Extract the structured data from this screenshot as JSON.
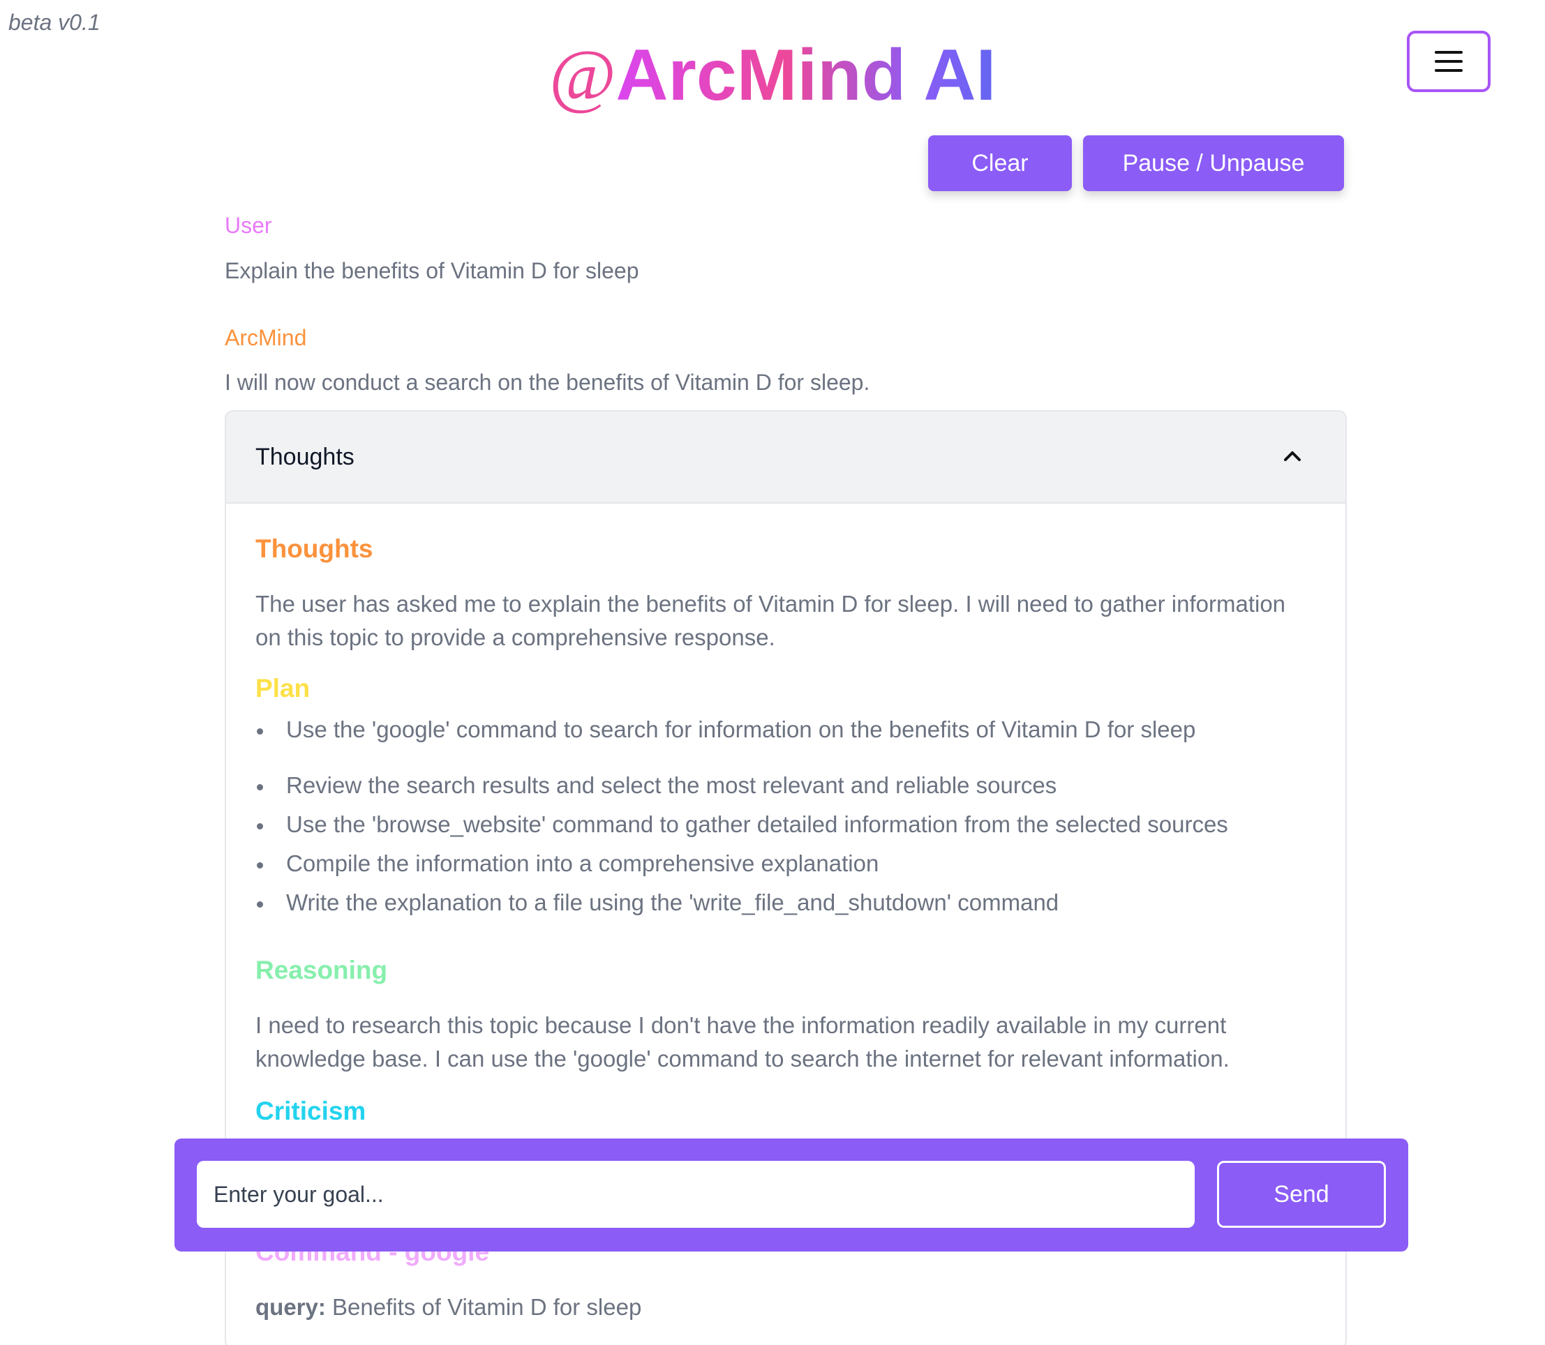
{
  "header": {
    "version": "beta v0.1",
    "logo_at": "@",
    "logo_name": "ArcMind AI",
    "menu_icon": "hamburger-menu-icon"
  },
  "toolbar": {
    "clear_label": "Clear",
    "pause_label": "Pause / Unpause"
  },
  "messages": [
    {
      "sender": "User",
      "text": "Explain the benefits of Vitamin D for sleep"
    },
    {
      "sender": "ArcMind",
      "text": "I will now conduct a search on the benefits of Vitamin D for sleep."
    }
  ],
  "thoughts_panel": {
    "title": "Thoughts",
    "expanded": true,
    "toggle_icon": "chevron-up-icon",
    "thoughts_heading": "Thoughts",
    "thoughts_text": "The user has asked me to explain the benefits of Vitamin D for sleep. I will need to gather information on this topic to provide a comprehensive response.",
    "plan_heading": "Plan",
    "plan_items": [
      "Use the 'google' command to search for information on the benefits of Vitamin D for sleep",
      "Review the search results and select the most relevant and reliable sources",
      "Use the 'browse_website' command to gather detailed information from the selected sources",
      "Compile the information into a comprehensive explanation",
      "Write the explanation to a file using the 'write_file_and_shutdown' command"
    ],
    "reasoning_heading": "Reasoning",
    "reasoning_text": "I need to research this topic because I don't have the information readily available in my current knowledge base. I can use the 'google' command to search the internet for relevant information.",
    "criticism_heading": "Criticism",
    "command_heading": "Command - google",
    "query_label": "query:",
    "query_value": "Benefits of Vitamin D for sleep"
  },
  "input_bar": {
    "placeholder": "Enter your goal...",
    "value": "",
    "send_label": "Send"
  },
  "colors": {
    "accent": "#8b5cf6",
    "user_label": "#e879f9",
    "arcmind_label": "#fb923c",
    "plan_heading": "#fde047",
    "reasoning_heading": "#86efac",
    "criticism_heading": "#22d3ee",
    "command_heading": "#f0abfc"
  }
}
